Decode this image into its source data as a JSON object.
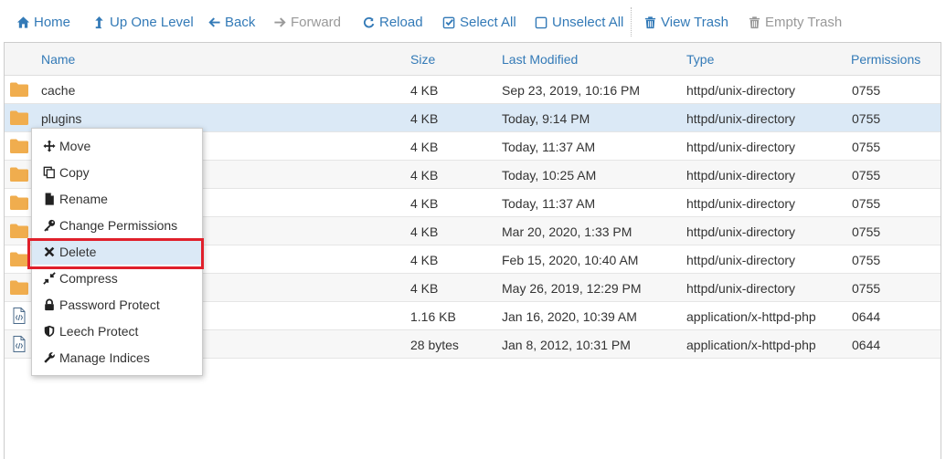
{
  "toolbar": {
    "home": "Home",
    "up_one_level": "Up One Level",
    "back": "Back",
    "forward": "Forward",
    "reload": "Reload",
    "select_all": "Select All",
    "unselect_all": "Unselect All",
    "view_trash": "View Trash",
    "empty_trash": "Empty Trash"
  },
  "table": {
    "columns": {
      "name": "Name",
      "size": "Size",
      "last_modified": "Last Modified",
      "type": "Type",
      "permissions": "Permissions"
    },
    "rows": [
      {
        "name": "cache",
        "size": "4 KB",
        "modified": "Sep 23, 2019, 10:16 PM",
        "type": "httpd/unix-directory",
        "perms": "0755",
        "icon": "folder-icon"
      },
      {
        "name": "plugins",
        "size": "4 KB",
        "modified": "Today, 9:14 PM",
        "type": "httpd/unix-directory",
        "perms": "0755",
        "icon": "folder-icon"
      },
      {
        "name": "",
        "size": "4 KB",
        "modified": "Today, 11:37 AM",
        "type": "httpd/unix-directory",
        "perms": "0755",
        "icon": "folder-icon"
      },
      {
        "name": "",
        "size": "4 KB",
        "modified": "Today, 10:25 AM",
        "type": "httpd/unix-directory",
        "perms": "0755",
        "icon": "folder-icon"
      },
      {
        "name": "",
        "size": "4 KB",
        "modified": "Today, 11:37 AM",
        "type": "httpd/unix-directory",
        "perms": "0755",
        "icon": "folder-icon"
      },
      {
        "name": "",
        "size": "4 KB",
        "modified": "Mar 20, 2020, 1:33 PM",
        "type": "httpd/unix-directory",
        "perms": "0755",
        "icon": "folder-icon"
      },
      {
        "name": "",
        "size": "4 KB",
        "modified": "Feb 15, 2020, 10:40 AM",
        "type": "httpd/unix-directory",
        "perms": "0755",
        "icon": "folder-icon"
      },
      {
        "name": "",
        "size": "4 KB",
        "modified": "May 26, 2019, 12:29 PM",
        "type": "httpd/unix-directory",
        "perms": "0755",
        "icon": "folder-icon"
      },
      {
        "name": "",
        "size": "1.16 KB",
        "modified": "Jan 16, 2020, 10:39 AM",
        "type": "application/x-httpd-php",
        "perms": "0644",
        "icon": "php-file-icon"
      },
      {
        "name": "",
        "size": "28 bytes",
        "modified": "Jan 8, 2012, 10:31 PM",
        "type": "application/x-httpd-php",
        "perms": "0644",
        "icon": "php-file-icon"
      }
    ]
  },
  "context_menu": {
    "items": [
      {
        "label": "Move",
        "icon": "move-icon"
      },
      {
        "label": "Copy",
        "icon": "copy-icon"
      },
      {
        "label": "Rename",
        "icon": "file-icon"
      },
      {
        "label": "Change Permissions",
        "icon": "key-icon"
      },
      {
        "label": "Delete",
        "icon": "close-icon"
      },
      {
        "label": "Compress",
        "icon": "compress-icon"
      },
      {
        "label": "Password Protect",
        "icon": "lock-icon"
      },
      {
        "label": "Leech Protect",
        "icon": "shield-icon"
      },
      {
        "label": "Manage Indices",
        "icon": "wrench-icon"
      }
    ]
  },
  "colors": {
    "link": "#337ab7",
    "disabled": "#999999",
    "folder": "#f0ad4e",
    "selected_row": "#dbe9f6",
    "highlight_border": "#e0202b"
  }
}
